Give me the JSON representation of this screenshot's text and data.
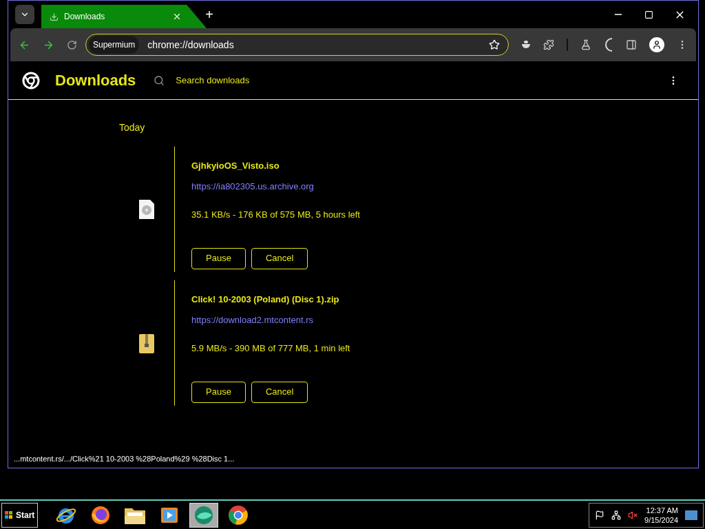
{
  "browser": {
    "tabs": [
      {
        "title": "Downloads",
        "selected": true
      }
    ],
    "new_tab": "+",
    "address_bar": {
      "chip": "Supermium",
      "url": "chrome://downloads"
    }
  },
  "page": {
    "title": "Downloads",
    "search": {
      "placeholder": "Search downloads"
    },
    "section": "Today",
    "downloads": [
      {
        "kind": "disc",
        "name": "GjhkyioOS_Visto.iso",
        "url": "https://ia802305.us.archive.org",
        "status": "35.1 KB/s - 176 KB of 575 MB, 5 hours left",
        "buttons": [
          "Pause",
          "Cancel"
        ]
      },
      {
        "kind": "zip",
        "name": "Click! 10-2003 (Poland) (Disc 1).zip",
        "url": "https://download2.mtcontent.rs",
        "status": "5.9 MB/s - 390 MB of 777 MB, 1 min left",
        "buttons": [
          "Pause",
          "Cancel"
        ]
      }
    ]
  },
  "status_bar": "...mtcontent.rs/.../Click%21 10-2003 %28Poland%29 %28Disc 1...",
  "taskbar": {
    "start": "Start",
    "apps": [
      {
        "kind": "ie",
        "selected": false
      },
      {
        "kind": "firefox",
        "selected": false
      },
      {
        "kind": "folder",
        "selected": false
      },
      {
        "kind": "media",
        "selected": false
      },
      {
        "kind": "app",
        "selected": true
      },
      {
        "kind": "chrome",
        "selected": false
      }
    ],
    "time": "12:37 AM",
    "date": "9/15/2024"
  }
}
